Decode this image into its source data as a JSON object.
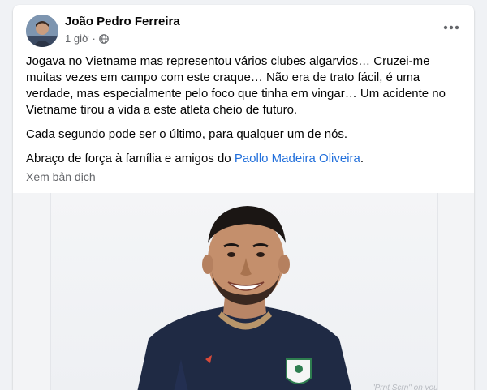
{
  "post": {
    "author": "João Pedro Ferreira",
    "time": "1 giờ",
    "privacy_icon": "globe-icon",
    "more_icon": "more-options-icon",
    "paragraphs": [
      "Jogava no Vietname mas representou vários clubes algarvios… Cruzei-me muitas vezes em campo com este craque… Não era de trato fácil, é uma verdade, mas especialmente pelo foco que tinha em vingar… Um acidente no Vietname tirou a vida a este atleta cheio de futuro.",
      "Cada segundo pode ser o último, para qualquer um de nós."
    ],
    "closing_prefix": "Abraço de força à família e amigos do ",
    "tagged_person": "Paollo Madeira Oliveira",
    "closing_suffix": ".",
    "translate_link": "Xem bản dịch",
    "photo_watermark": "\"Prnt Scrn\" on your"
  },
  "colors": {
    "link": "#216fdb",
    "secondary_text": "#65676b",
    "jersey": "#1f2a44",
    "jersey_trim": "#b8956a"
  }
}
